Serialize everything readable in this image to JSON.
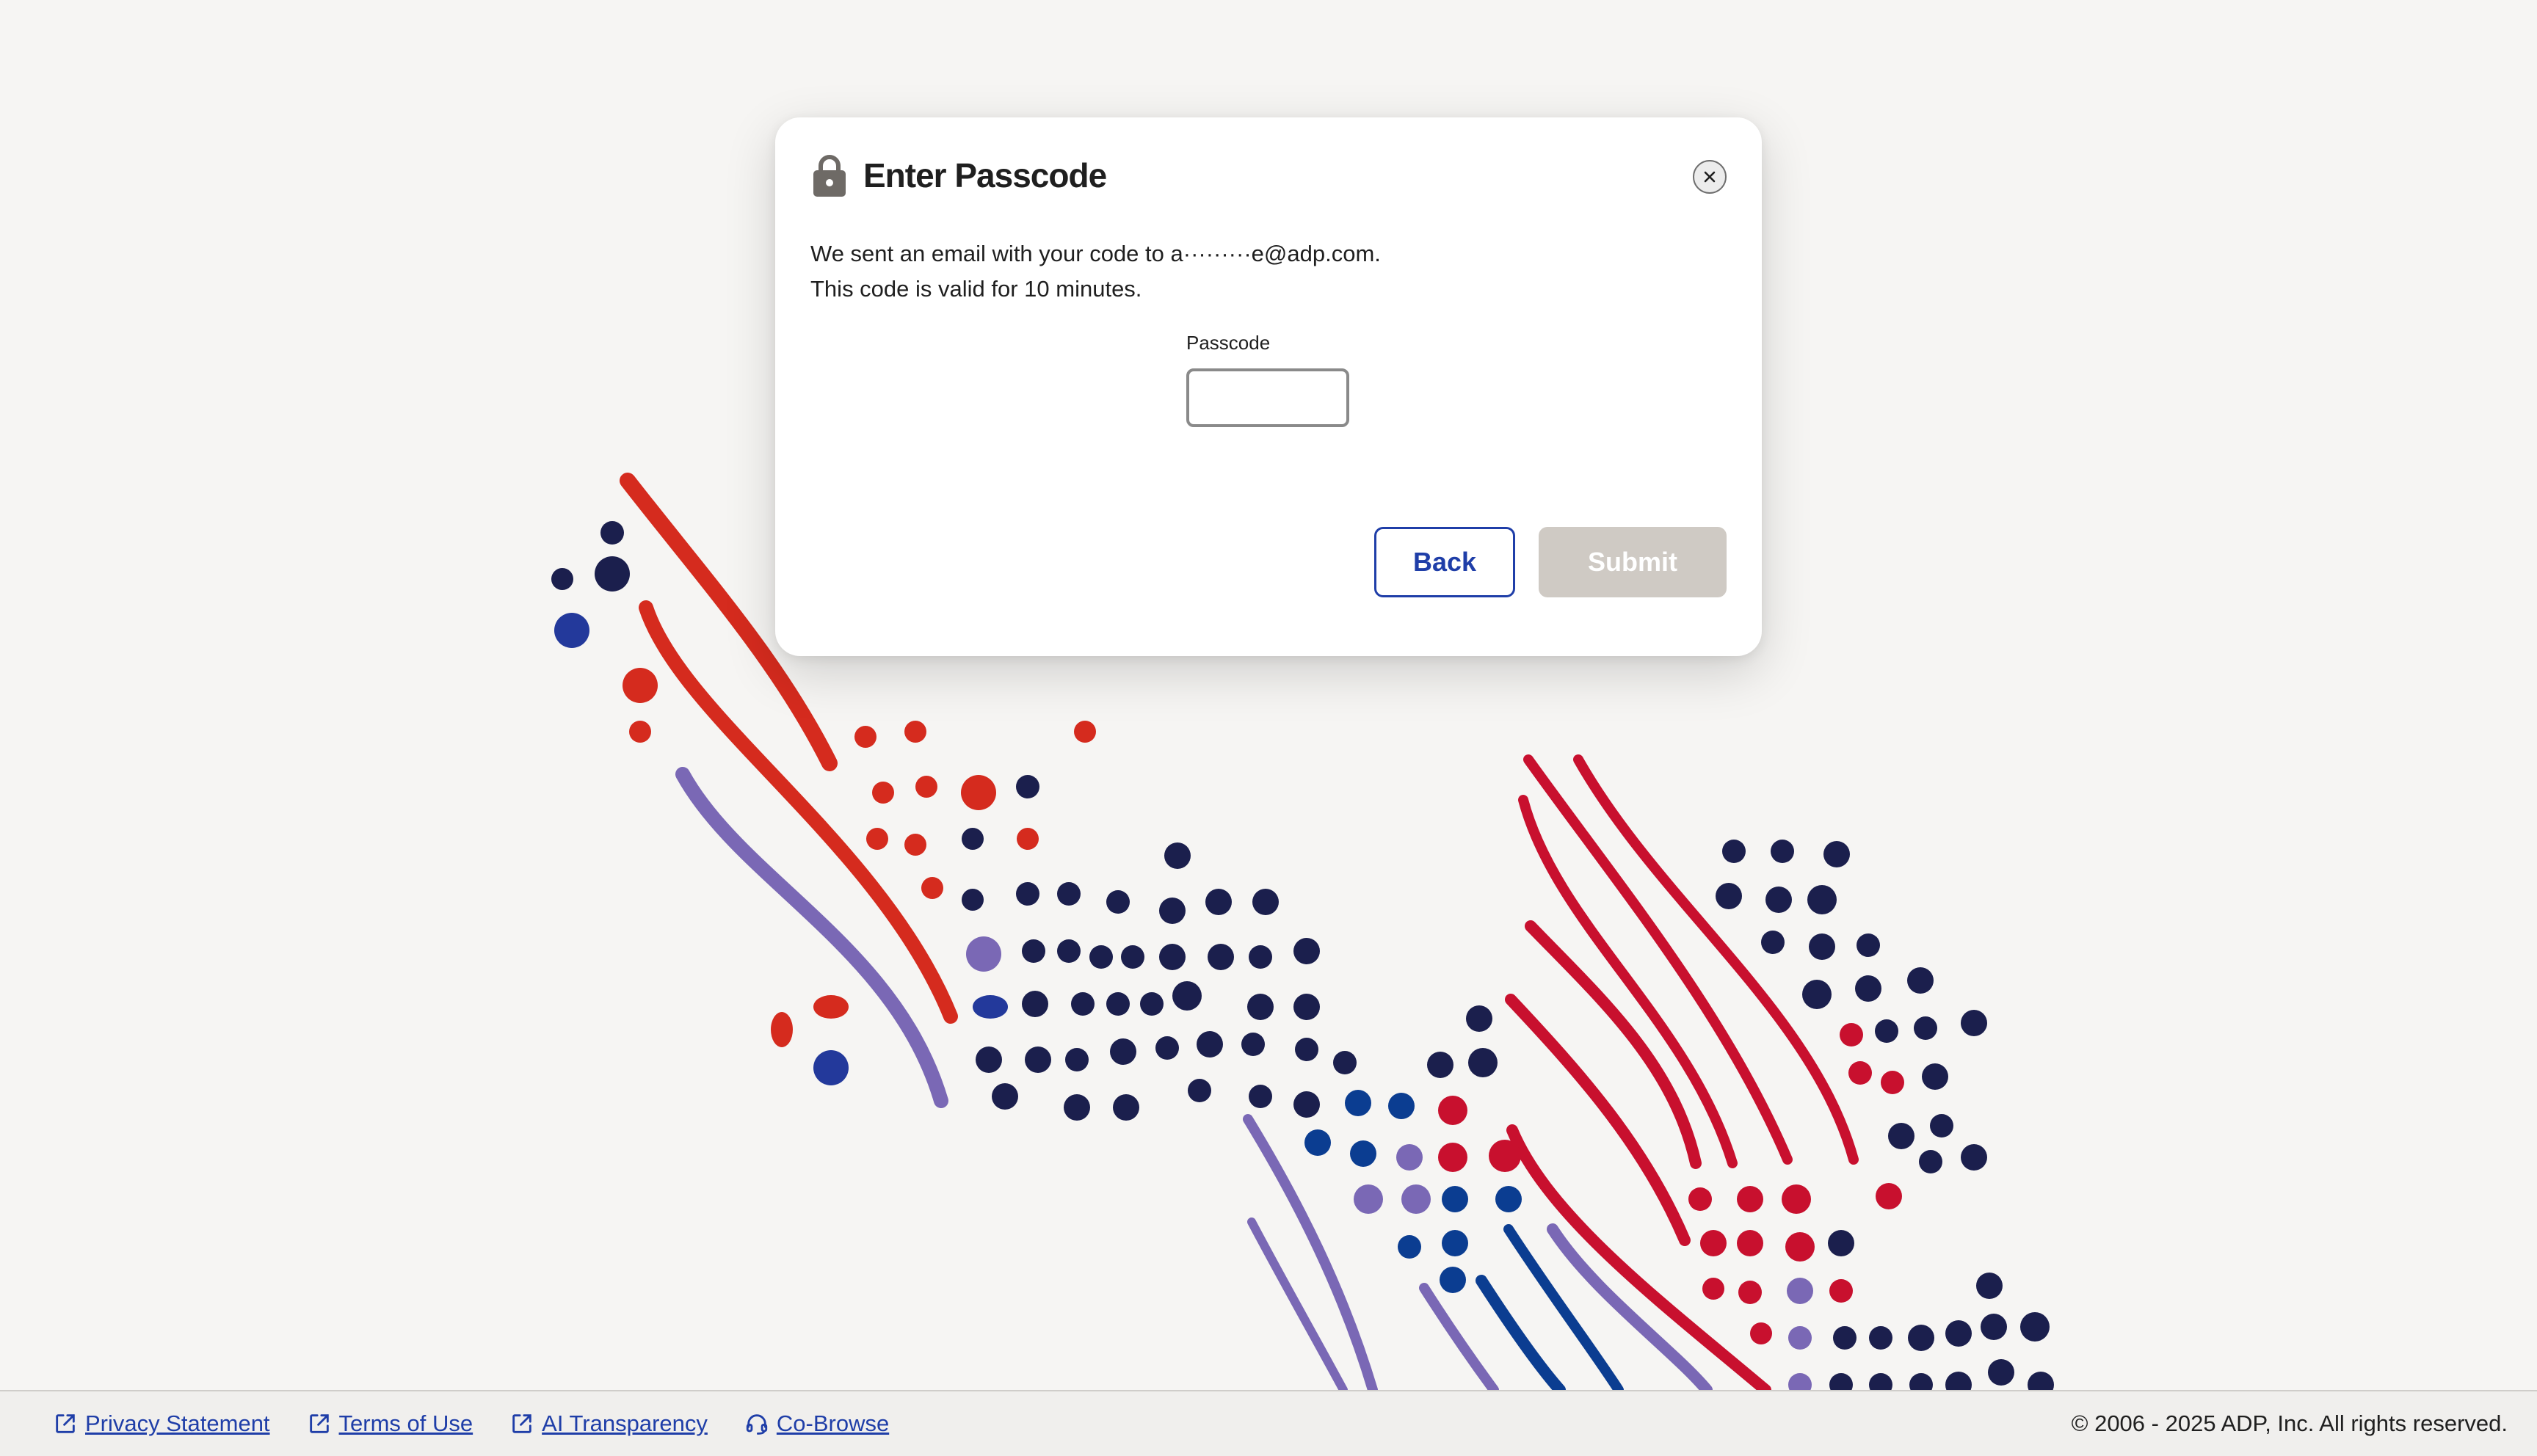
{
  "modal": {
    "title": "Enter Passcode",
    "message_line1": "We sent an email with your code to a·········e@adp.com.",
    "message_line2": "This code is valid for 10 minutes.",
    "passcode_label": "Passcode",
    "passcode_value": "",
    "back_label": "Back",
    "submit_label": "Submit",
    "submit_state": "disabled"
  },
  "footer": {
    "links": [
      {
        "label": "Privacy Statement",
        "icon": "external-link-icon"
      },
      {
        "label": "Terms of Use",
        "icon": "external-link-icon"
      },
      {
        "label": "AI Transparency",
        "icon": "external-link-icon"
      },
      {
        "label": "Co-Browse",
        "icon": "headset-icon"
      }
    ],
    "copyright": "© 2006 - 2025 ADP, Inc. All rights reserved."
  },
  "colors": {
    "background": "#f6f5f3",
    "link": "#1f3ea8",
    "red": "#d52b1e",
    "crimson": "#c8102e",
    "navy": "#1b1f4d",
    "purple": "#7a68b5",
    "blue": "#23399b",
    "submit_disabled": "#cfcac4"
  }
}
